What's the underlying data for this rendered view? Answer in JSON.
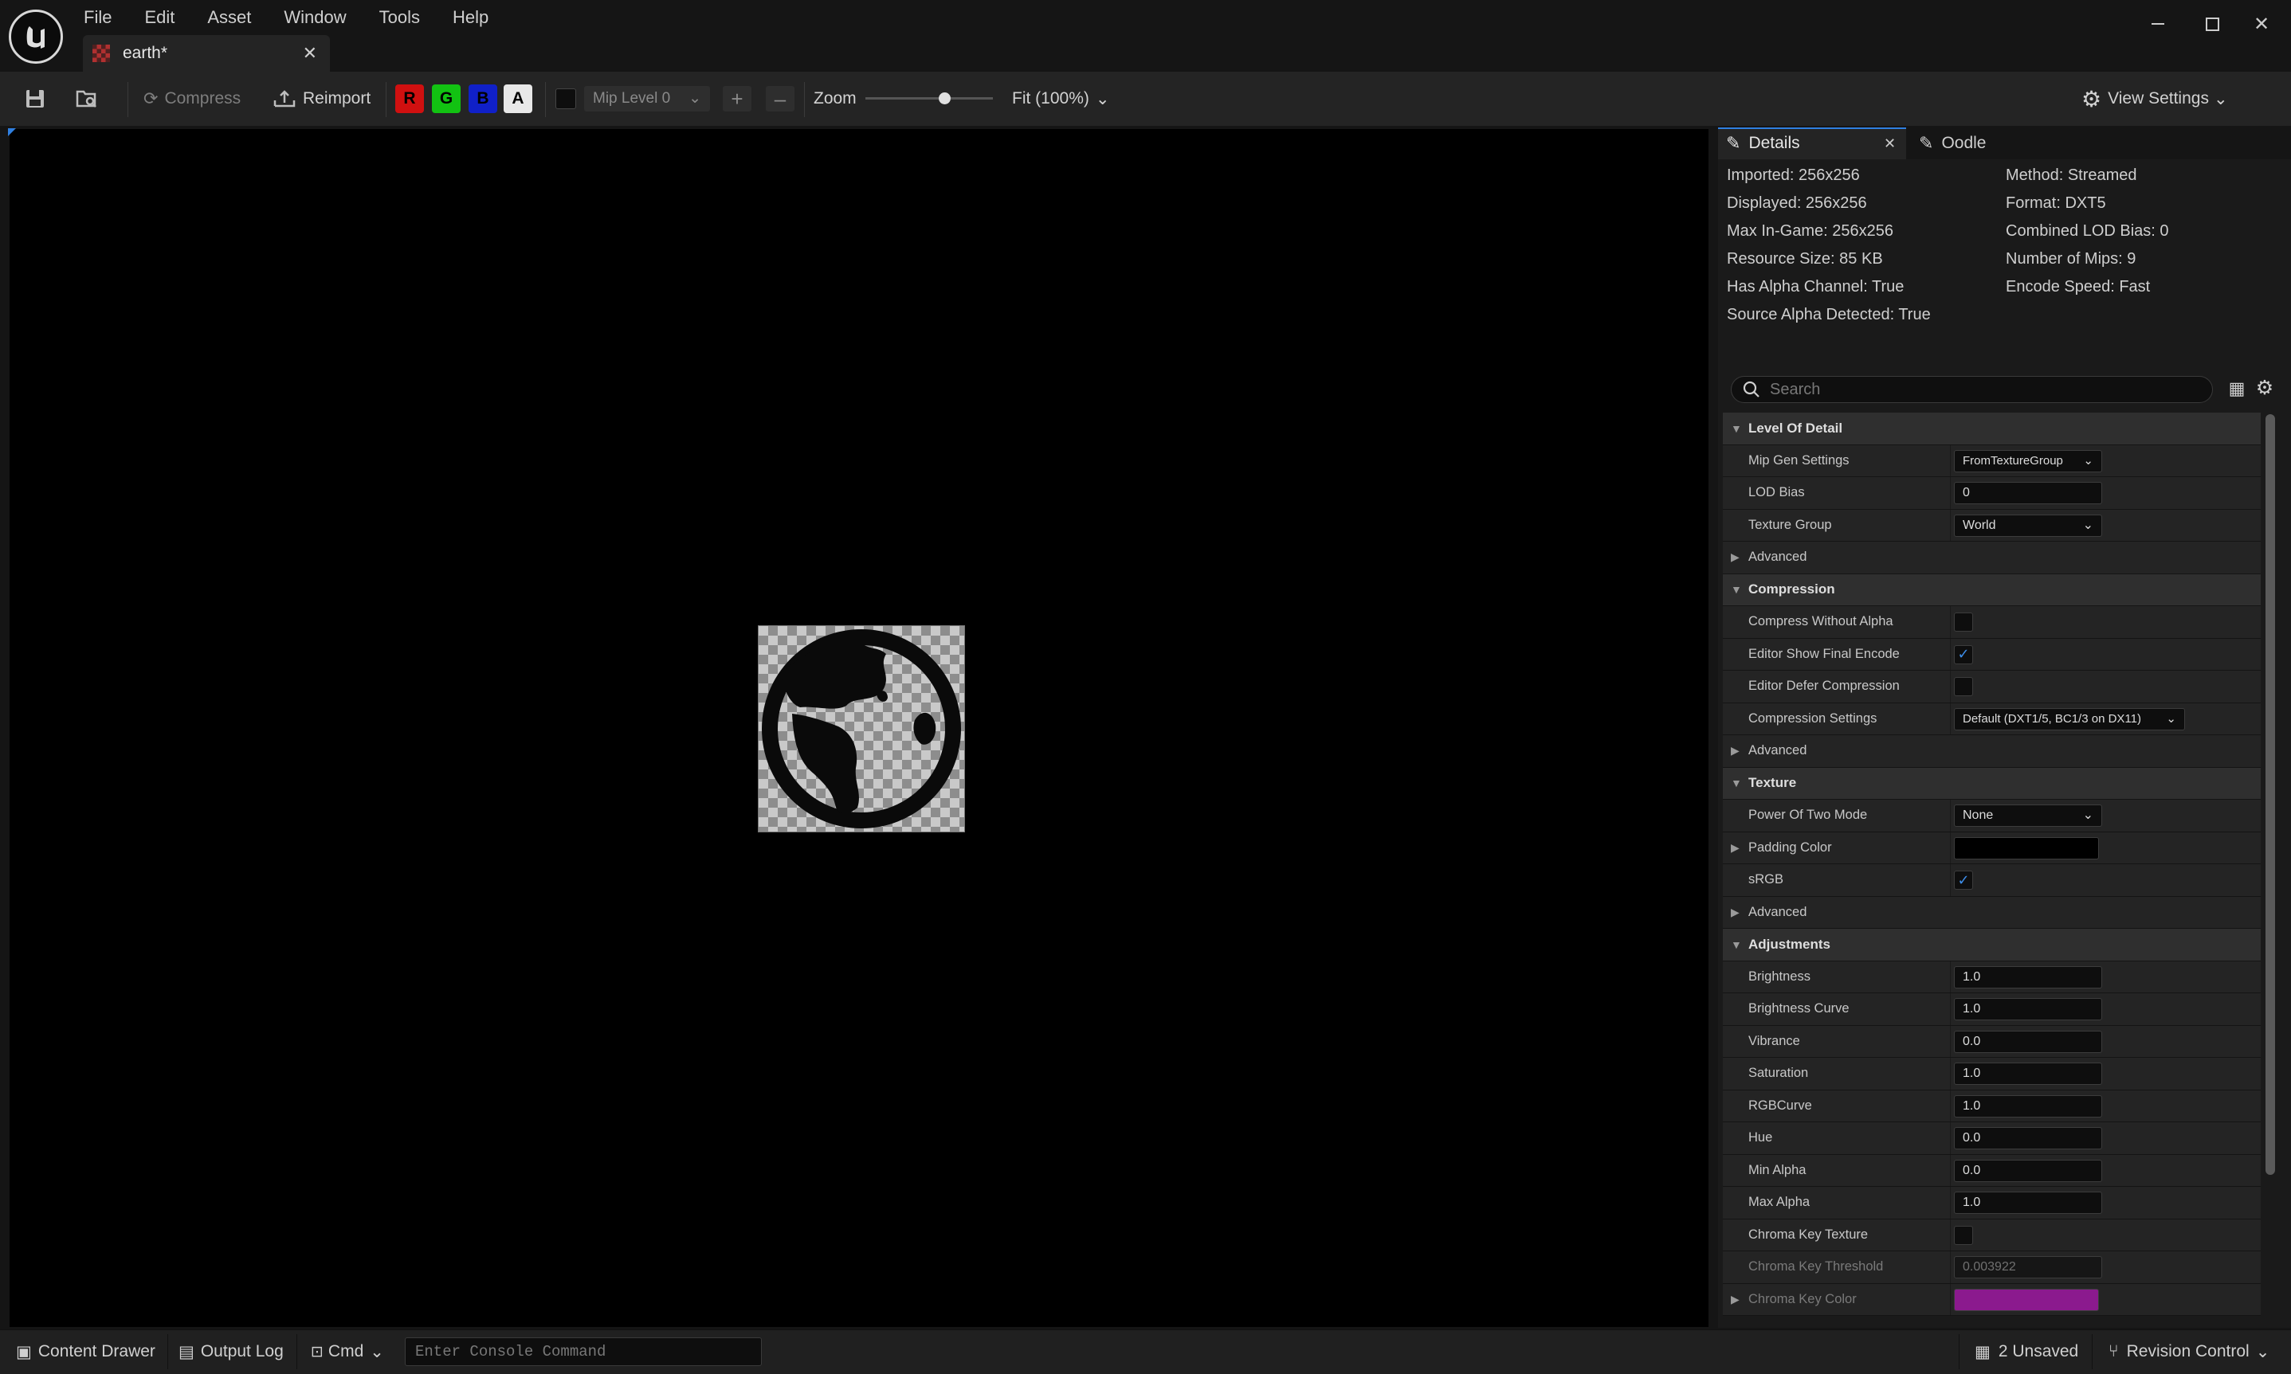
{
  "window": {
    "tab_title": "earth*"
  },
  "menu": [
    "File",
    "Edit",
    "Asset",
    "Window",
    "Tools",
    "Help"
  ],
  "toolbar": {
    "compress_label": "Compress",
    "reimport_label": "Reimport",
    "channels": {
      "r": "R",
      "g": "G",
      "b": "B",
      "a": "A"
    },
    "channel_colors": {
      "r": "#d01010",
      "g": "#12c212",
      "b": "#1020c8",
      "a": "#e8e8e8"
    },
    "mip_level": "Mip Level 0",
    "zoom_label": "Zoom",
    "zoom_value": 0.62,
    "fit_label": "Fit (100%)",
    "view_settings_label": "View Settings"
  },
  "details": {
    "tab_details": "Details",
    "tab_oodle": "Oodle",
    "info_left": [
      "Imported: 256x256",
      "Displayed: 256x256",
      "Max In-Game: 256x256",
      "Resource Size: 85 KB",
      "Has Alpha Channel: True",
      "Source Alpha Detected: True"
    ],
    "info_right": [
      "Method: Streamed",
      "Format: DXT5",
      "Combined LOD Bias: 0",
      "Number of Mips: 9",
      "Encode Speed: Fast"
    ],
    "search_placeholder": "Search"
  },
  "props": {
    "lod": {
      "title": "Level Of Detail",
      "mip_gen_label": "Mip Gen Settings",
      "mip_gen_value": "FromTextureGroup",
      "lod_bias_label": "LOD Bias",
      "lod_bias_value": "0",
      "texture_group_label": "Texture Group",
      "texture_group_value": "World",
      "advanced": "Advanced"
    },
    "compression": {
      "title": "Compression",
      "without_alpha": "Compress Without Alpha",
      "show_final": "Editor Show Final Encode",
      "defer": "Editor Defer Compression",
      "settings_label": "Compression Settings",
      "settings_value": "Default (DXT1/5, BC1/3 on DX11)",
      "advanced": "Advanced"
    },
    "texture": {
      "title": "Texture",
      "pot_label": "Power Of Two Mode",
      "pot_value": "None",
      "padding_label": "Padding Color",
      "srgb_label": "sRGB",
      "advanced": "Advanced",
      "padding_color": "#000000"
    },
    "adjustments": {
      "title": "Adjustments",
      "brightness": "Brightness",
      "brightness_v": "1.0",
      "brightness_curve": "Brightness Curve",
      "brightness_curve_v": "1.0",
      "vibrance": "Vibrance",
      "vibrance_v": "0.0",
      "saturation": "Saturation",
      "saturation_v": "1.0",
      "rgbcurve": "RGBCurve",
      "rgbcurve_v": "1.0",
      "hue": "Hue",
      "hue_v": "0.0",
      "min_alpha": "Min Alpha",
      "min_alpha_v": "0.0",
      "max_alpha": "Max Alpha",
      "max_alpha_v": "1.0",
      "chroma_tex": "Chroma Key Texture",
      "chroma_threshold": "Chroma Key Threshold",
      "chroma_threshold_v": "0.003922",
      "chroma_color": "Chroma Key Color",
      "chroma_color_value": "#8b1a8e"
    }
  },
  "status": {
    "content_drawer": "Content Drawer",
    "output_log": "Output Log",
    "cmd": "Cmd",
    "console_placeholder": "Enter Console Command",
    "unsaved": "2 Unsaved",
    "revision": "Revision Control"
  }
}
